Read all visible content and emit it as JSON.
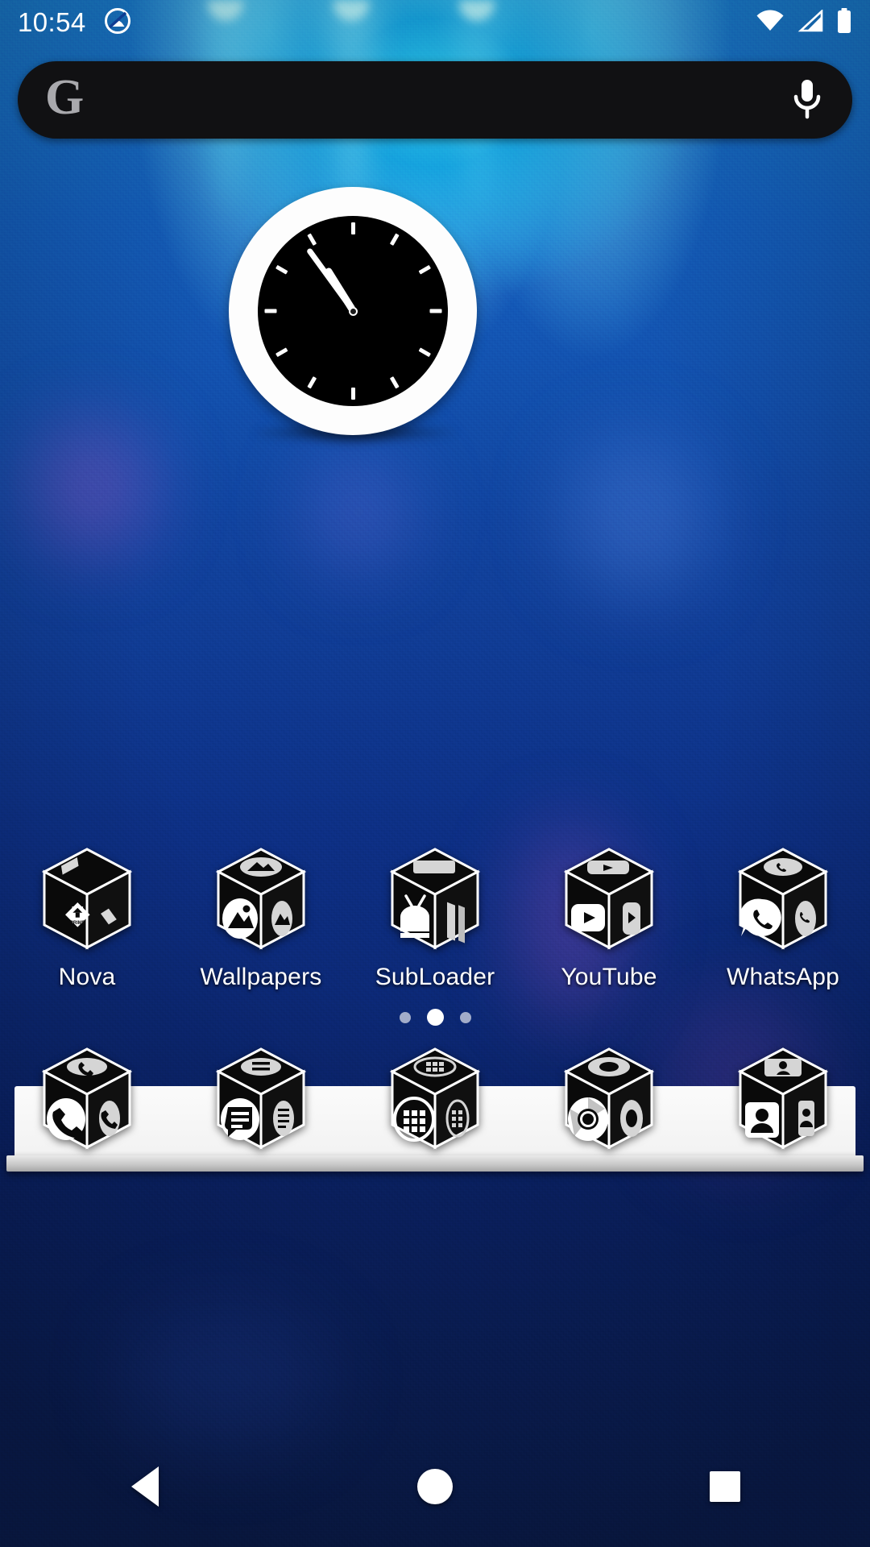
{
  "status_bar": {
    "time": "10:54",
    "notification_icon": "circle-slash-icon",
    "wifi_icon": "wifi-full-icon",
    "signal_icon": "cellular-signal-icon",
    "battery_icon": "battery-full-icon"
  },
  "search": {
    "logo": "google-g-logo",
    "placeholder": "",
    "value": "",
    "mic_icon": "microphone-icon",
    "background_color": "#111113",
    "logo_color": "#a9a9ad"
  },
  "clock_widget": {
    "name": "analog-clock-widget",
    "displayed_time": "10:54",
    "hour_angle_deg": 328,
    "minute_angle_deg": 324,
    "ring_color": "#fdfdfd",
    "face_color": "#000000",
    "hand_color": "#ffffff"
  },
  "app_row": {
    "apps": [
      {
        "label": "Nova",
        "icon": "nova-launcher-prime-icon"
      },
      {
        "label": "Wallpapers",
        "icon": "wallpapers-picture-icon"
      },
      {
        "label": "SubLoader",
        "icon": "subloader-android-tv-icon"
      },
      {
        "label": "YouTube",
        "icon": "youtube-play-icon"
      },
      {
        "label": "WhatsApp",
        "icon": "whatsapp-phone-bubble-icon"
      }
    ]
  },
  "page_indicator": {
    "total": 3,
    "active_index": 1
  },
  "dock": {
    "apps": [
      {
        "label": "Phone",
        "icon": "phone-handset-icon"
      },
      {
        "label": "Messages",
        "icon": "messages-bubble-icon"
      },
      {
        "label": "Apps",
        "icon": "app-drawer-grid-icon"
      },
      {
        "label": "Chrome",
        "icon": "chrome-circle-icon"
      },
      {
        "label": "Contacts",
        "icon": "contacts-person-icon"
      }
    ],
    "shelf_color": "#f7f7f7"
  },
  "nav_bar": {
    "back_label": "Back",
    "home_label": "Home",
    "recents_label": "Recents",
    "back_icon": "triangle-back-icon",
    "home_icon": "circle-home-icon",
    "recents_icon": "square-recents-icon"
  },
  "wallpaper": {
    "description": "blue textured fabric with cyan spotlight beams",
    "primary_color": "#11439e",
    "accent_color": "#2fd0f5"
  }
}
